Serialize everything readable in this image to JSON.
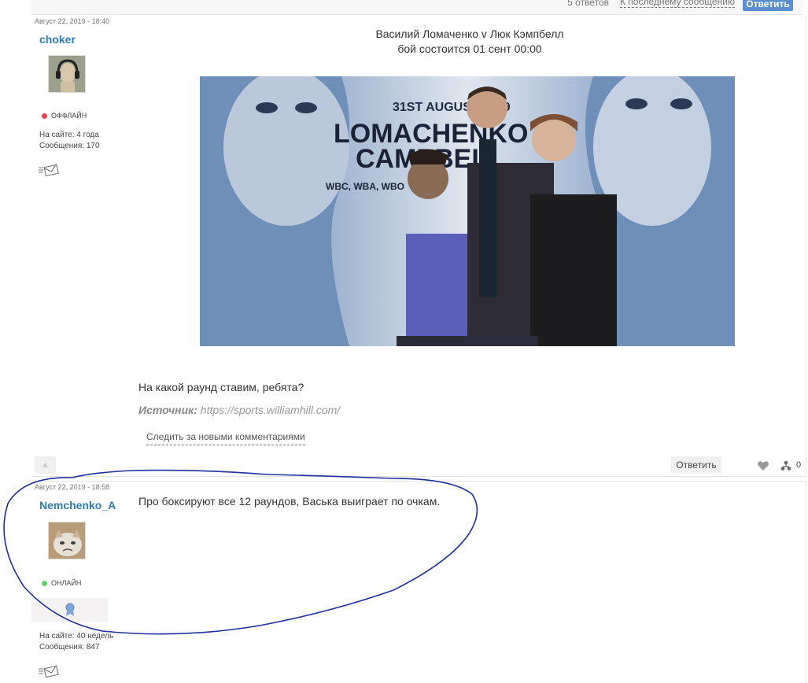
{
  "topbar": {
    "replies": "5 ответов",
    "last_message": "К последнему сообщению",
    "reply": "Ответить"
  },
  "post1": {
    "date": "Август 22, 2019 - 18:40",
    "username": "choker",
    "status": "ОФФЛАЙН",
    "on_site": "На сайте: 4 года",
    "messages": "Сообщения: 170",
    "title_line1": "Василий Ломаченко v Люк Кэмпбелл",
    "title_line2": "бой состоится  01 сент 00:00",
    "image": {
      "date_text": "31ST AUGUST 2019",
      "name1": "LOMACHENKO",
      "name2": "CAMPBELL",
      "belts": "WBC, WBA, WBO"
    },
    "question": "На какой раунд ставим, ребята?",
    "source_label": "Источник:",
    "source_url": "https://sports.williamhill.com/",
    "follow": "Следить за новыми комментариями",
    "reply": "Ответить",
    "likes": "0",
    "status_color": "#e0425a"
  },
  "post2": {
    "date": "Август 22, 2019 - 18:58",
    "username": "Nemchenko_A",
    "status": "ОНЛАЙН",
    "on_site": "На сайте: 40 недель",
    "messages": "Сообщения: 847",
    "text": "Про боксируют все 12 раундов, Васька выиграет по очкам.",
    "status_color": "#5ecf68"
  },
  "colors": {
    "username": "#2c7cae",
    "annotation": "#1f2fa0",
    "reply_button": "#5b8fd0"
  }
}
